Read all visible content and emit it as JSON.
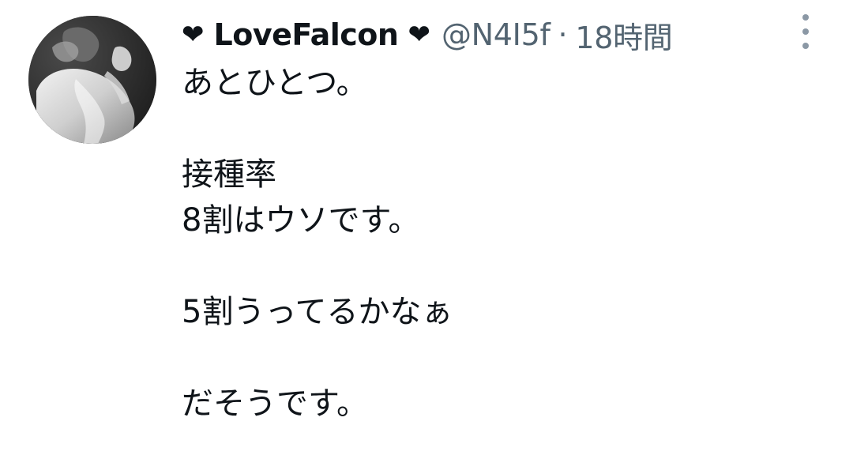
{
  "tweet": {
    "heart_icon": "heart-icon",
    "heart_char": "❤",
    "display_name": "LoveFalcon",
    "handle": "@N4I5f",
    "separator": "·",
    "timestamp": "18時間",
    "more_icon": "more-vertical-icon",
    "lines": [
      "あとひとつ。",
      "",
      "接種率",
      "8割はウソです。",
      "",
      "5割うってるかなぁ",
      "",
      "だそうです。"
    ]
  },
  "colors": {
    "text": "#0f1419",
    "secondary": "#536471",
    "background": "#ffffff"
  }
}
